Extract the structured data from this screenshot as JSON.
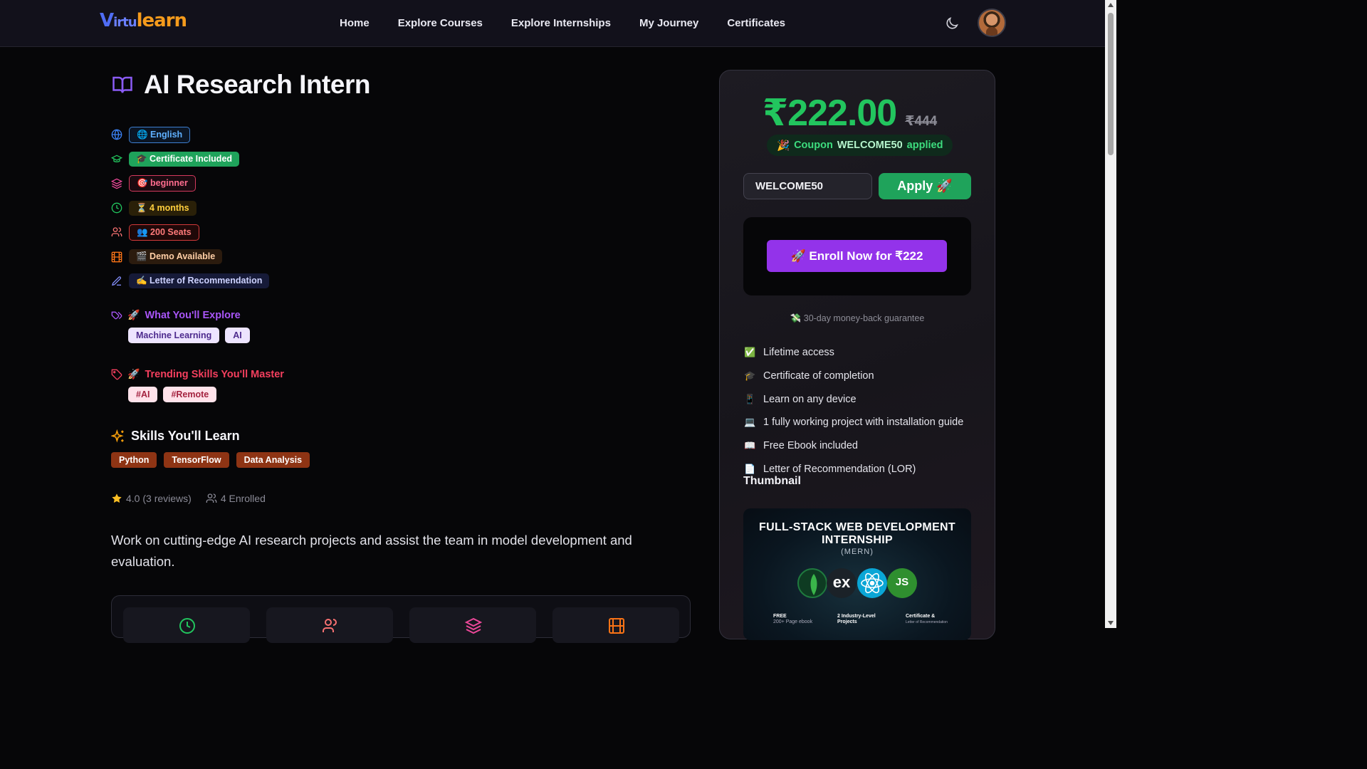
{
  "nav": {
    "logo": {
      "v": "V",
      "irtu": "irtu",
      "learn": "learn"
    },
    "links": [
      "Home",
      "Explore Courses",
      "Explore Internships",
      "My Journey",
      "Certificates"
    ]
  },
  "course": {
    "title": "AI Research Intern",
    "meta": {
      "language": "🌐 English",
      "certificate": "🎓 Certificate Included",
      "level": "🎯 beginner",
      "duration": "⏳ 4 months",
      "seats": "👥 200 Seats",
      "demo": "🎬 Demo Available",
      "lor": "✍️ Letter of Recommendation"
    },
    "explore": {
      "emoji": "🚀",
      "title": "What You'll Explore",
      "tags": [
        "Machine Learning",
        "AI"
      ]
    },
    "trending": {
      "emoji": "🚀",
      "title": "Trending Skills You'll Master",
      "tags": [
        "#AI",
        "#Remote"
      ]
    },
    "skills": {
      "title": "Skills You'll Learn",
      "items": [
        "Python",
        "TensorFlow",
        "Data Analysis"
      ]
    },
    "rating": "4.0 (3 reviews)",
    "enrolled": "4 Enrolled",
    "description": "Work on cutting-edge AI research projects and assist the team in model development and evaluation."
  },
  "pricing": {
    "price": "₹222.00",
    "original": "₹444",
    "coupon_emoji": "🎉",
    "coupon_prefix": "Coupon",
    "coupon_code": "WELCOME50",
    "coupon_suffix": "applied",
    "input_value": "WELCOME50",
    "apply_label": "Apply 🚀",
    "enroll_label": "🚀 Enroll Now for ₹222",
    "guarantee": "💸 30-day money-back guarantee",
    "features": [
      {
        "emoji": "✅",
        "text": "Lifetime access"
      },
      {
        "emoji": "🎓",
        "text": "Certificate of completion"
      },
      {
        "emoji": "📱",
        "text": "Learn on any device"
      },
      {
        "emoji": "💻",
        "text": "1 fully working project with installation guide"
      },
      {
        "emoji": "📖",
        "text": "Free Ebook included"
      },
      {
        "emoji": "📄",
        "text": "Letter of Recommendation (LOR)"
      }
    ],
    "thumbnail_label": "Thumbnail",
    "thumbnail": {
      "title_line1": "FULL-STACK WEB DEVELOPMENT",
      "title_line2": "INTERNSHIP",
      "subtitle": "(MERN)",
      "orb_ex": "ex",
      "orb_js": "JS",
      "foot1": "FREE",
      "foot1_sub": "200+ Page ebook",
      "foot2": "2 Industry-Level",
      "foot2_sub": "Projects",
      "foot3": "Certificate &",
      "foot3_sub": "Letter of Recommendation"
    }
  },
  "colors": {
    "accent_green": "#22c55e",
    "accent_purple": "#9333ea",
    "nav_bg": "#12111b",
    "page_bg": "#060608"
  }
}
